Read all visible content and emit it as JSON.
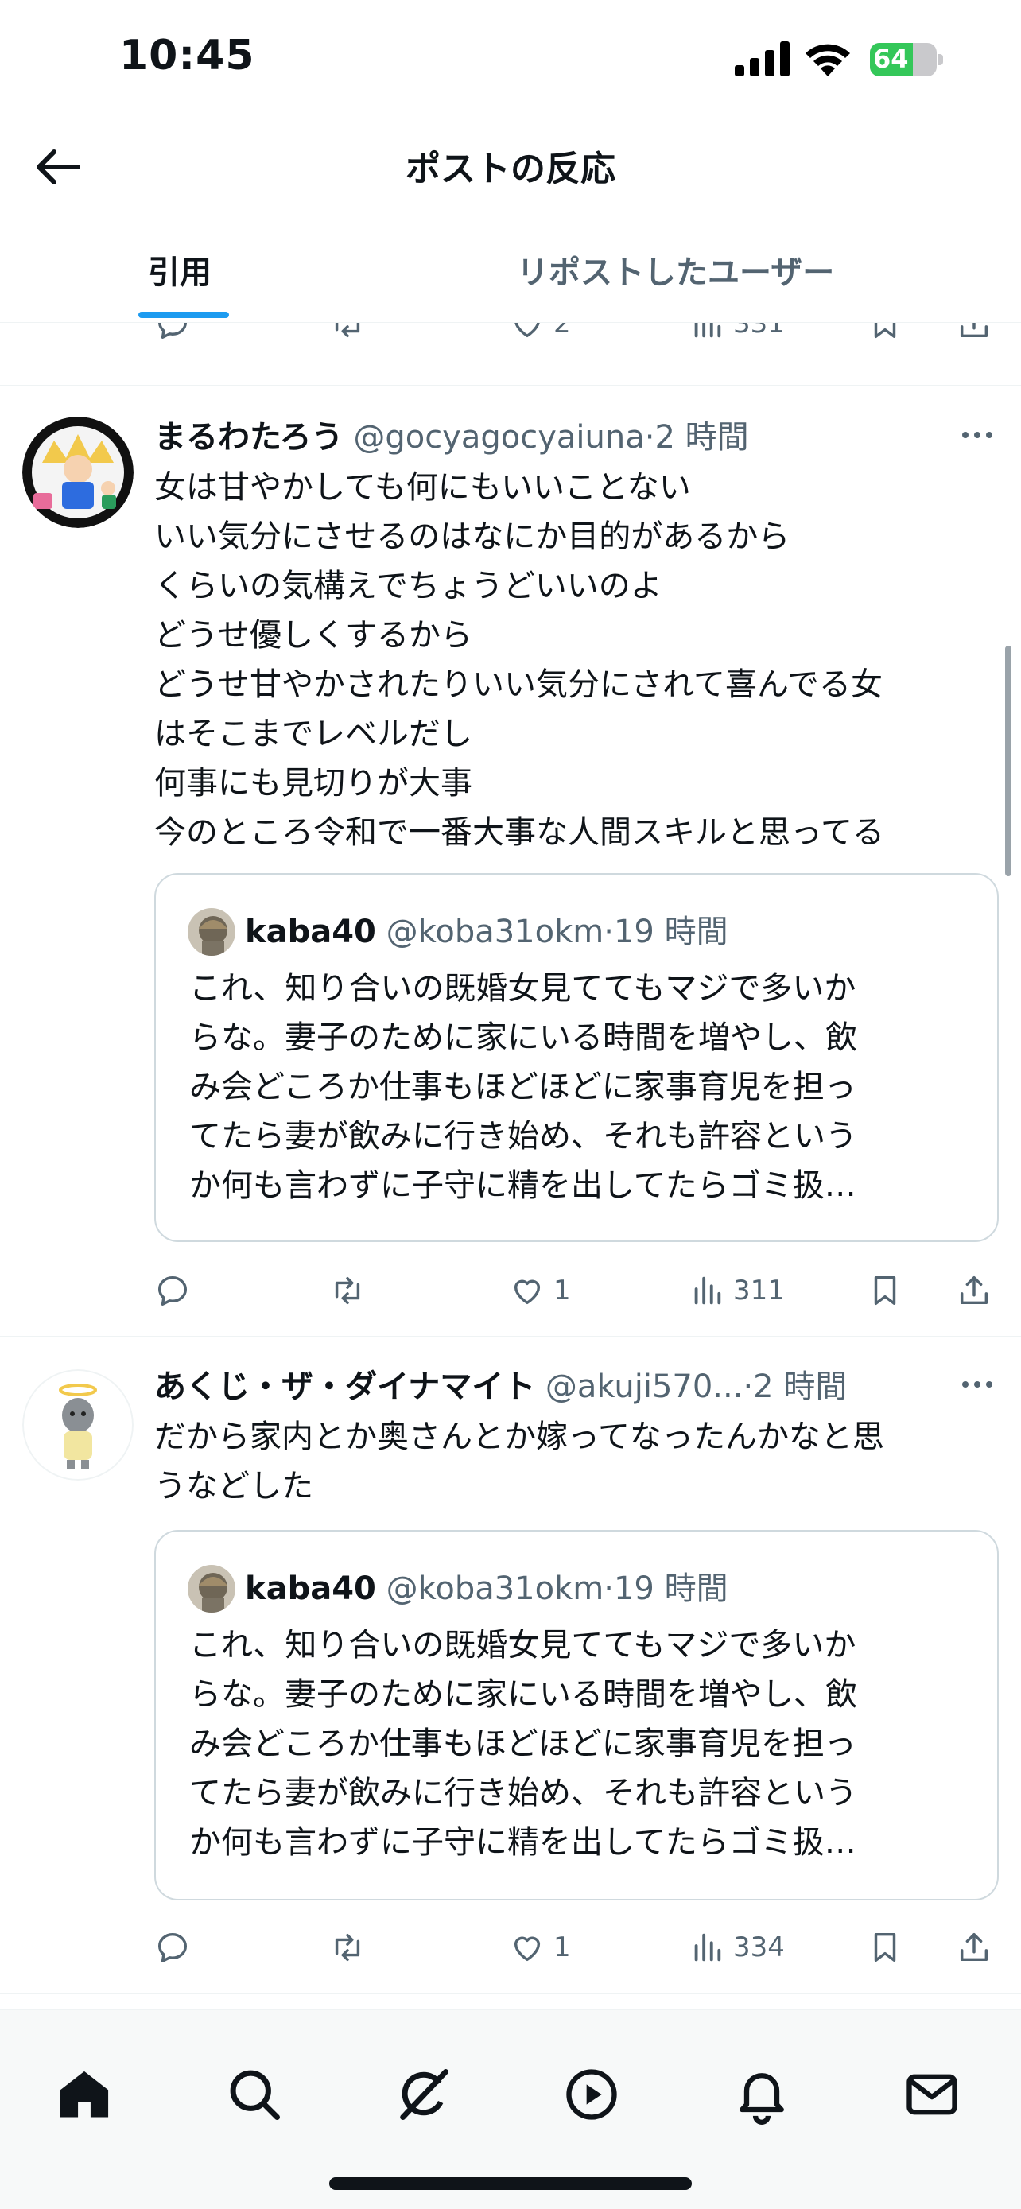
{
  "status_bar": {
    "time": "10:45",
    "battery": "64",
    "battery_level": 0.64
  },
  "header": {
    "title": "ポストの反応"
  },
  "tabs": [
    {
      "label": "引用",
      "active": true
    },
    {
      "label": "リポストしたユーザー",
      "active": false
    }
  ],
  "top_actions": {
    "likes": "2",
    "views": "331"
  },
  "posts": [
    {
      "name": "まるわたろう",
      "handle": "@gocyagocyaiuna",
      "sep": "·",
      "time": "2 時間",
      "text": "女は甘やかしても何にもいいことない\nいい気分にさせるのはなにか目的があるから\nくらいの気構えでちょうどいいのよ\nどうせ優しくするから\nどうせ甘やかされたりいい気分にされて喜んでる女\nはそこまでレベルだし\n何事にも見切りが大事\n今のところ令和で一番大事な人間スキルと思ってる",
      "quote": {
        "name": "kaba40",
        "handle": "@koba31okm",
        "sep": "·",
        "time": "19 時間",
        "text": "これ、知り合いの既婚女見ててもマジで多いか\nらな。妻子のために家にいる時間を増やし、飲\nみ会どころか仕事もほどほどに家事育児を担っ\nてたら妻が飲みに行き始め、それも許容という\nか何も言わずに子守に精を出してたらゴミ扱…"
      },
      "likes": "1",
      "views": "311"
    },
    {
      "name": "あくじ・ザ・ダイナマイト",
      "handle": "@akuji570...",
      "sep": "·",
      "time": "2 時間",
      "text": "だから家内とか奥さんとか嫁ってなったんかなと思\nうなどした",
      "quote": {
        "name": "kaba40",
        "handle": "@koba31okm",
        "sep": "·",
        "time": "19 時間",
        "text": "これ、知り合いの既婚女見ててもマジで多いか\nらな。妻子のために家にいる時間を増やし、飲\nみ会どころか仕事もほどほどに家事育児を担っ\nてたら妻が飲みに行き始め、それも許容という\nか何も言わずに子守に精を出してたらゴミ扱…"
      },
      "likes": "1",
      "views": "334"
    }
  ],
  "icons": {
    "reply": "reply-icon",
    "repost": "repost-icon",
    "like": "heart-icon",
    "views": "views-icon",
    "bookmark": "bookmark-icon",
    "share": "share-icon"
  },
  "bottom_nav": [
    "home-icon",
    "search-icon",
    "grok-icon",
    "video-icon",
    "notifications-icon",
    "messages-icon"
  ],
  "colors": {
    "accent": "#1d9bf0",
    "secondary_text": "#536471",
    "battery": "#34c759"
  }
}
